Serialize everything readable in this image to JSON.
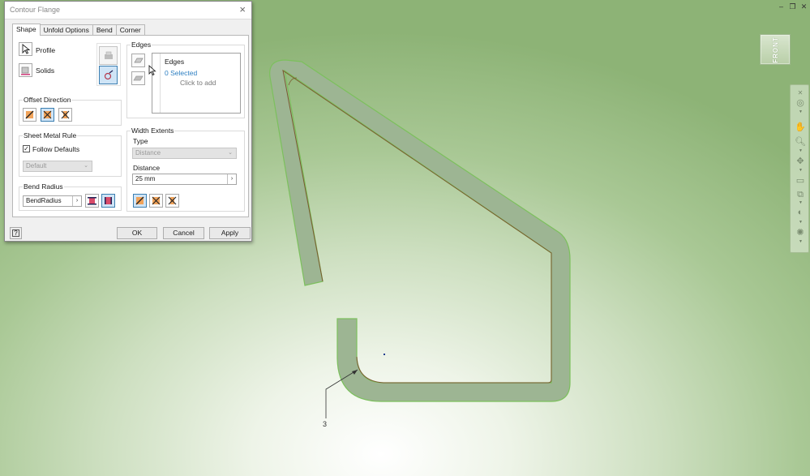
{
  "dialog": {
    "title": "Contour Flange",
    "tabs": [
      {
        "label": "Shape",
        "active": true
      },
      {
        "label": "Unfold Options"
      },
      {
        "label": "Bend"
      },
      {
        "label": "Corner"
      }
    ],
    "profile_label": "Profile",
    "solids_label": "Solids",
    "offset_direction": {
      "title": "Offset Direction"
    },
    "sheet_metal_rule": {
      "title": "Sheet Metal Rule",
      "follow_defaults_label": "Follow Defaults",
      "follow_defaults_checked": true,
      "rule_value": "Default"
    },
    "bend_radius": {
      "title": "Bend Radius",
      "value": "BendRadius"
    },
    "edges": {
      "group_title": "Edges",
      "list_title": "Edges",
      "selected_text": "0 Selected",
      "hint_text": "Click to add"
    },
    "width_extents": {
      "title": "Width Extents",
      "type_label": "Type",
      "type_value": "Distance",
      "distance_label": "Distance",
      "distance_value": "25 mm"
    },
    "buttons": {
      "ok": "OK",
      "cancel": "Cancel",
      "apply": "Apply"
    },
    "help_icon": "help-icon"
  },
  "viewport": {
    "viewcube_face": "FRONT",
    "dimension_label": "3",
    "colors": {
      "flange_fill": "#9db593",
      "flange_outline": "#7cc05d",
      "edge_line": "#7a5a2f"
    }
  },
  "window_controls": {
    "minimize": "–",
    "restore": "❐",
    "close": "✕"
  }
}
